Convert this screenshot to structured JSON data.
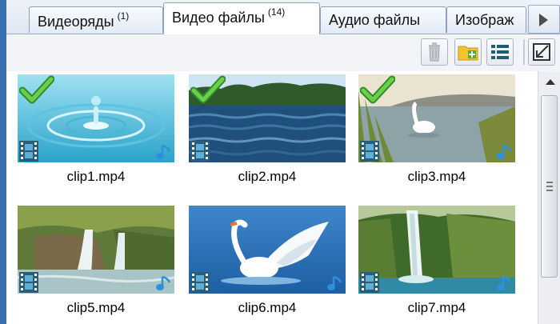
{
  "tabs": [
    {
      "label": "Видеоряды",
      "count": "(1)",
      "active": false
    },
    {
      "label": "Видео файлы",
      "count": "(14)",
      "active": true
    },
    {
      "label": "Аудио файлы",
      "count": "",
      "active": false
    },
    {
      "label": "Изображ",
      "count": "",
      "active": false
    }
  ],
  "toolbar": {
    "icons": [
      "trash-icon",
      "folder-add-icon",
      "list-view-icon",
      "collapse-icon"
    ]
  },
  "files": [
    {
      "name": "clip1.mp4",
      "checked": true,
      "audio": true,
      "scene": "water-drop"
    },
    {
      "name": "clip2.mp4",
      "checked": true,
      "audio": false,
      "scene": "lake"
    },
    {
      "name": "clip3.mp4",
      "checked": true,
      "audio": true,
      "scene": "swan-lake"
    },
    {
      "name": "clip5.mp4",
      "checked": false,
      "audio": true,
      "scene": "forest-waterfall"
    },
    {
      "name": "clip6.mp4",
      "checked": false,
      "audio": true,
      "scene": "swan-wings"
    },
    {
      "name": "clip7.mp4",
      "checked": false,
      "audio": true,
      "scene": "tall-waterfall"
    }
  ],
  "colors": {
    "accent": "#3a6fb0",
    "check": "#4caf3a",
    "audio": "#2f8fdc"
  }
}
